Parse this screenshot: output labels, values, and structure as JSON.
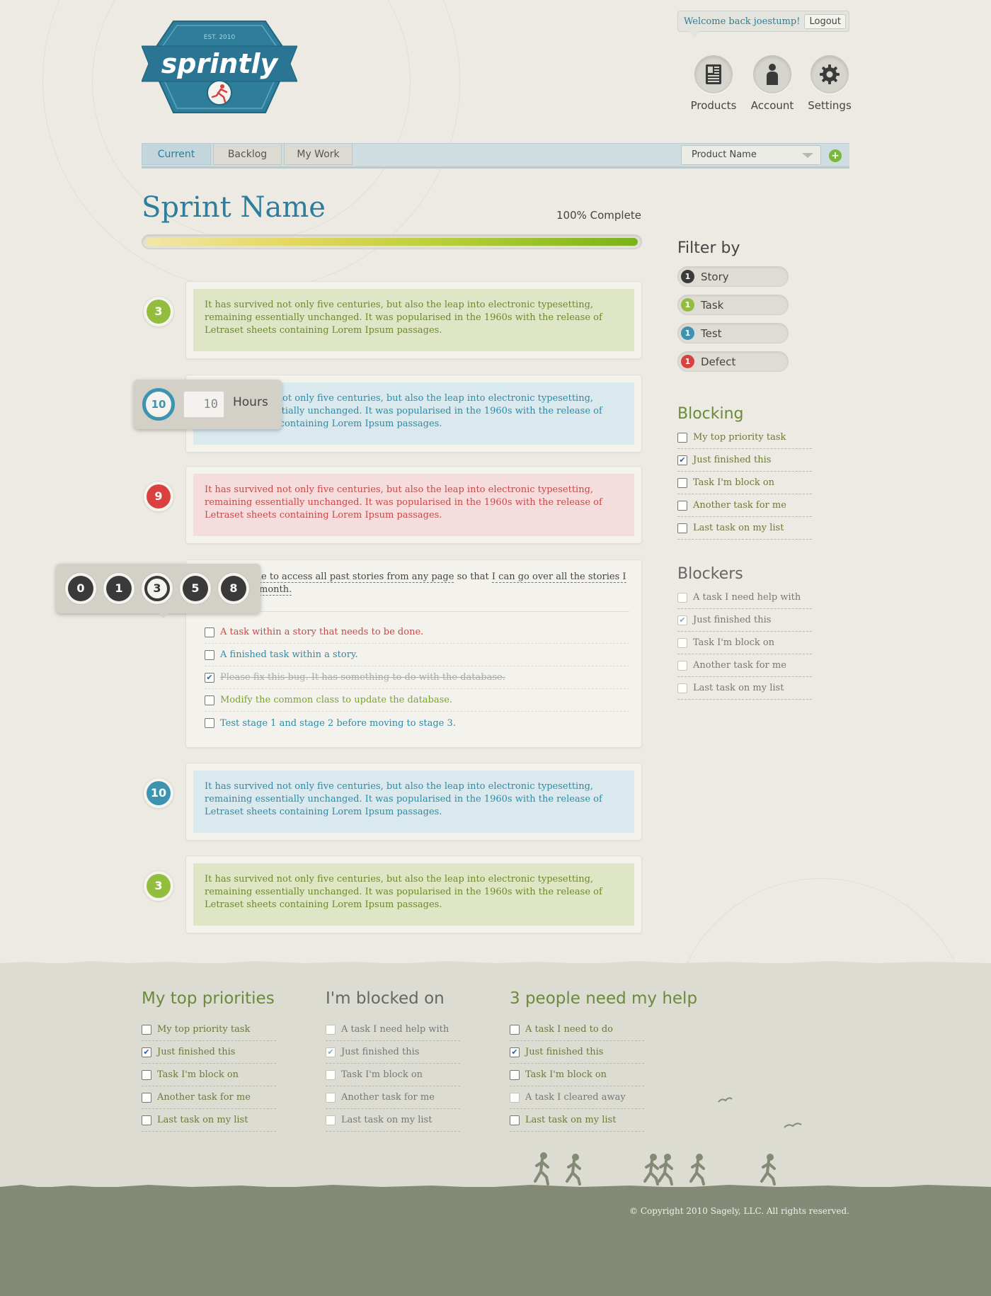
{
  "header": {
    "logo": {
      "name": "sprintly",
      "est": "EST. 2010"
    },
    "welcome": "Welcome back joestump!",
    "logout": "Logout",
    "nav": [
      {
        "label": "Products",
        "icon": "products-icon"
      },
      {
        "label": "Account",
        "icon": "account-icon"
      },
      {
        "label": "Settings",
        "icon": "gear-icon"
      }
    ]
  },
  "tabs": [
    "Current",
    "Backlog",
    "My Work"
  ],
  "product_select": {
    "value": "Product Name"
  },
  "sprint": {
    "title": "Sprint Name",
    "complete_label": "100% Complete",
    "progress": 1.0
  },
  "cards": [
    {
      "points": "3",
      "color": "green",
      "text": "It has survived not only five centuries, but also the leap into electronic typesetting, remaining essentially unchanged. It was popularised in the 1960s with the release of Letraset sheets containing Lorem Ipsum passages."
    },
    {
      "points": "10",
      "color": "blue",
      "text": "It has survived not only five centuries, but also the leap into electronic typesetting, remaining essentially unchanged. It was popularised in the 1960s with the release of Letraset sheets containing Lorem Ipsum passages."
    },
    {
      "points": "9",
      "color": "red",
      "text": "It has survived not only five centuries, but also the leap into electronic typesetting, remaining essentially unchanged. It was popularised in the 1960s with the release of Letraset sheets containing Lorem Ipsum passages."
    },
    {
      "points": "10",
      "color": "blue",
      "text": "It has survived not only five centuries, but also the leap into electronic typesetting, remaining essentially unchanged. It was popularised in the 1960s with the release of Letraset sheets containing Lorem Ipsum passages."
    },
    {
      "points": "3",
      "color": "green",
      "text": "It has survived not only five centuries, but also the leap into electronic typesetting, remaining essentially unchanged. It was popularised in the 1960s with the release of Letraset sheets containing Lorem Ipsum passages."
    }
  ],
  "story": {
    "line1_pre": "ant ",
    "line1_want": "to be able to access all past stories from any page",
    "line1_mid": " so that ",
    "line1_goal": "I can go over all the stories I",
    "line2": "month.",
    "tasks": [
      {
        "text": "A task within a story that needs to be done.",
        "checked": false,
        "color": "#c84848"
      },
      {
        "text": "A finished task within a story.",
        "checked": false,
        "color": "#2f8aa6"
      },
      {
        "text": "Please fix this bug. It has something to do with the database.",
        "checked": true,
        "color": "#aaaaaa"
      },
      {
        "text": "Modify the common class to update the database.",
        "checked": false,
        "color": "#7aa52a"
      },
      {
        "text": "Test stage 1 and stage 2 before moving to stage 3.",
        "checked": false,
        "color": "#2f8aa6"
      }
    ]
  },
  "hours_popup": {
    "points": "10",
    "value": "10",
    "label": "Hours"
  },
  "points_picker": {
    "options": [
      "0",
      "1",
      "3",
      "5",
      "8"
    ],
    "selected": "3"
  },
  "filter": {
    "title": "Filter by",
    "items": [
      {
        "label": "Story",
        "count": "1",
        "color": "#3a3a3a"
      },
      {
        "label": "Task",
        "count": "1",
        "color": "#93bd3f"
      },
      {
        "label": "Test",
        "count": "1",
        "color": "#3d93b0"
      },
      {
        "label": "Defect",
        "count": "1",
        "color": "#d8413f"
      }
    ]
  },
  "blocking": {
    "title": "Blocking",
    "items": [
      {
        "label": "My top priority task",
        "checked": false
      },
      {
        "label": "Just finished this",
        "checked": true
      },
      {
        "label": "Task I'm block on",
        "checked": false
      },
      {
        "label": "Another task for me",
        "checked": false
      },
      {
        "label": "Last task on my list",
        "checked": false
      }
    ]
  },
  "blockers": {
    "title": "Blockers",
    "items": [
      {
        "label": "A task I need help with",
        "checked": false
      },
      {
        "label": "Just finished this",
        "checked": true
      },
      {
        "label": "Task I'm block on",
        "checked": false
      },
      {
        "label": "Another task for me",
        "checked": false
      },
      {
        "label": "Last task on my list",
        "checked": false
      }
    ]
  },
  "footer": {
    "columns": [
      {
        "title": "My top priorities",
        "dim": false,
        "items": [
          {
            "label": "My top priority task",
            "checked": false,
            "dim": false
          },
          {
            "label": "Just finished this",
            "checked": true,
            "dim": false
          },
          {
            "label": "Task I'm block on",
            "checked": false,
            "dim": false
          },
          {
            "label": "Another task for me",
            "checked": false,
            "dim": false
          },
          {
            "label": "Last task on my list",
            "checked": false,
            "dim": false
          }
        ]
      },
      {
        "title": "I'm blocked on",
        "dim": true,
        "items": [
          {
            "label": "A task I need help with",
            "checked": false,
            "dim": true
          },
          {
            "label": "Just finished this",
            "checked": true,
            "dim": true
          },
          {
            "label": "Task I'm block on",
            "checked": false,
            "dim": true
          },
          {
            "label": "Another task for me",
            "checked": false,
            "dim": true
          },
          {
            "label": "Last task on my list",
            "checked": false,
            "dim": true
          }
        ]
      },
      {
        "title": "3 people need my help",
        "dim": false,
        "items": [
          {
            "label": "A task I need to do",
            "checked": false,
            "dim": false
          },
          {
            "label": "Just finished this",
            "checked": true,
            "dim": false
          },
          {
            "label": "Task I'm block on",
            "checked": false,
            "dim": false
          },
          {
            "label": "A task I cleared away",
            "checked": false,
            "dim": true
          },
          {
            "label": "Last task on my list",
            "checked": false,
            "dim": false
          }
        ]
      }
    ],
    "copyright": "© Copyright 2010 Sagely, LLC. All rights reserved."
  },
  "colors": {
    "brand_blue": "#2d7d9b",
    "green": "#93bd3f",
    "blue": "#3d93b0",
    "red": "#d8413f",
    "olive_text": "#6b7a3a"
  }
}
